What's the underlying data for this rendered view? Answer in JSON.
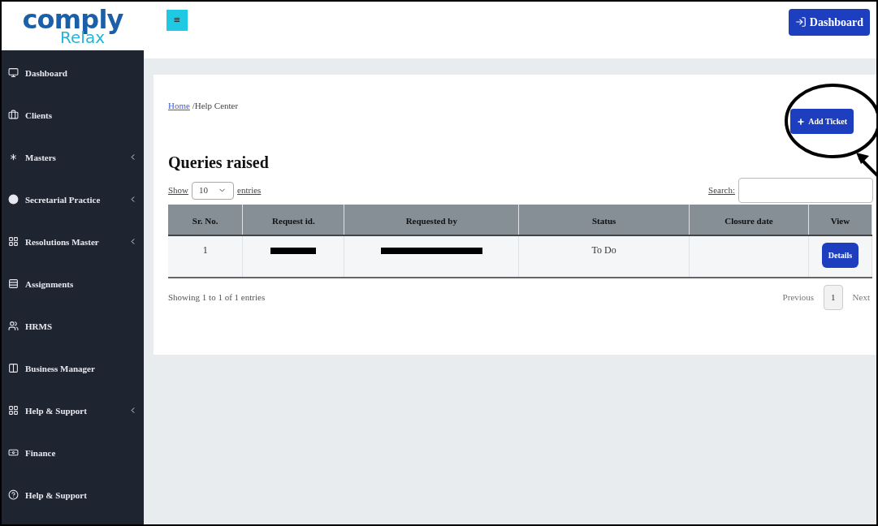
{
  "logo": {
    "line_1": "comply",
    "line_2": "Relax"
  },
  "header": {
    "menu_toggle": "≡",
    "dashboard_button": "Dashboard"
  },
  "sidebar": {
    "items": [
      {
        "label": "Dashboard",
        "has_submenu": false
      },
      {
        "label": "Clients",
        "has_submenu": false
      },
      {
        "label": "Masters",
        "has_submenu": true
      },
      {
        "label": "Secretarial Practice",
        "has_submenu": true
      },
      {
        "label": "Resolutions Master",
        "has_submenu": true
      },
      {
        "label": "Assignments",
        "has_submenu": false
      },
      {
        "label": "HRMS",
        "has_submenu": false
      },
      {
        "label": "Business Manager",
        "has_submenu": false
      },
      {
        "label": "Help & Support",
        "has_submenu": true
      },
      {
        "label": "Finance",
        "has_submenu": false
      },
      {
        "label": "Help & Support",
        "has_submenu": false
      }
    ]
  },
  "breadcrumb": {
    "link": "Home",
    "current": "/Help Center"
  },
  "add_button": "Add Ticket",
  "title": "Queries raised",
  "length_menu": {
    "before": "Show",
    "value": "10",
    "after": "entries"
  },
  "search": {
    "label": "Search:"
  },
  "table": {
    "columns": [
      "Sr. No.",
      "Request id.",
      "Requested by",
      "Status",
      "Closure date",
      "View"
    ],
    "rows": [
      {
        "cells": [
          {
            "kind": "text",
            "text": "1"
          },
          {
            "kind": "redacted"
          },
          {
            "kind": "redacted"
          },
          {
            "kind": "text",
            "text": "To Do"
          },
          {
            "kind": "empty"
          },
          {
            "kind": "button",
            "text": "Details"
          }
        ]
      }
    ]
  },
  "info": "Showing 1 to 1 of 1 entries",
  "pagination": {
    "previous": "Previous",
    "pages": [
      {
        "label": "1",
        "selected": true
      }
    ],
    "next": "Next"
  }
}
